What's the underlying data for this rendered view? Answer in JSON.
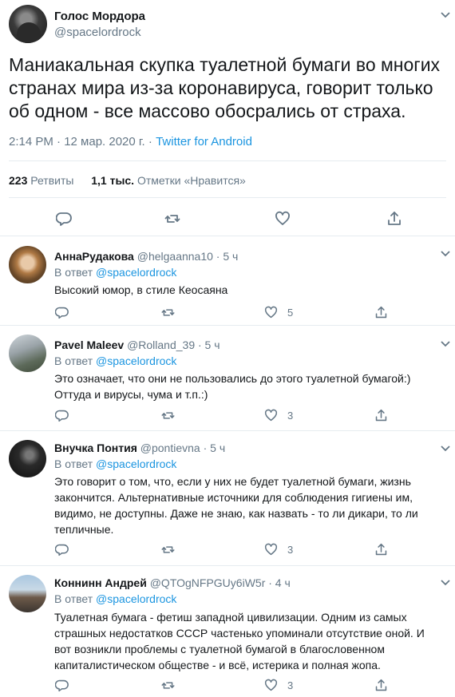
{
  "main": {
    "author_name": "Голос Мордора",
    "author_handle": "@spacelordrock",
    "text": "Маниакальная скупка туалетной бумаги во многих странах мира из-за коронавируса, говорит только об одном - все массово обосрались от страха.",
    "timestamp": "2:14 PM · 12 мар. 2020 г. · ",
    "source_app": "Twitter for Android",
    "retweets_count": "223",
    "retweets_label": "Ретвиты",
    "likes_count": "1,1 тыс.",
    "likes_label": "Отметки «Нравится»",
    "icons": [
      "reply-icon",
      "retweet-icon",
      "like-icon",
      "share-icon",
      "chevron-down-icon"
    ]
  },
  "replies": [
    {
      "name": "АннаРудакова",
      "handle": "@helgaanna10",
      "time": " · 5 ч",
      "reply_to_label": "В ответ ",
      "reply_to_handle": "@spacelordrock",
      "text": "Высокий юмор, в стиле Кеосаяна",
      "retweets": "",
      "likes": "5"
    },
    {
      "name": "Pavel Maleev",
      "handle": "@Rolland_39",
      "time": " · 5 ч",
      "reply_to_label": "В ответ ",
      "reply_to_handle": "@spacelordrock",
      "text": "Это означает, что они не пользовались до этого туалетной бумагой:) Оттуда и вирусы, чума и т.п.:)",
      "retweets": "",
      "likes": "3"
    },
    {
      "name": "Внучка Понтия",
      "handle": "@pontievna",
      "time": " · 5 ч",
      "reply_to_label": "В ответ ",
      "reply_to_handle": "@spacelordrock",
      "text": "Это говорит о том, что, если у них не будет туалетной бумаги, жизнь закончится. Альтернативные источники для соблюдения гигиены им, видимо, не доступны. Даже не знаю, как назвать - то ли дикари, то ли тепличные.",
      "retweets": "",
      "likes": "3"
    },
    {
      "name": "Коннинн Андрей",
      "handle": "@QTOgNFPGUy6iW5r",
      "time": " · 4 ч",
      "reply_to_label": "В ответ ",
      "reply_to_handle": "@spacelordrock",
      "text": "Туалетная бумага - фетиш западной цивилизации. Одним из самых страшных недостатков СССР частенько упоминали отсутствие оной. И вот возникли проблемы с туалетной бумагой в благословенном капиталистическом обществе - и всё, истерика и полная жопа.",
      "retweets": "",
      "likes": "3"
    }
  ],
  "colors": {
    "text": "#14171a",
    "secondary": "#657786",
    "link": "#1b95e0",
    "border": "#e6ecf0"
  }
}
